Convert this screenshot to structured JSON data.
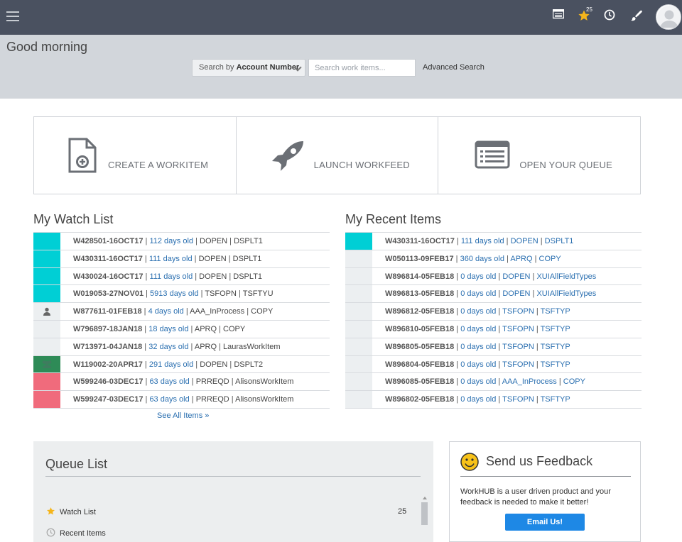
{
  "header": {
    "favorites_count": "25",
    "colors": {
      "bar": "#4a5160",
      "band": "#d2d6db"
    }
  },
  "greeting": "Good morning",
  "search": {
    "by_prefix": "Search by",
    "by_value": "Account Number",
    "placeholder": "Search work items...",
    "advanced_label": "Advanced Search"
  },
  "tiles": [
    {
      "label": "CREATE A WORKITEM",
      "icon": "document-add-icon"
    },
    {
      "label": "LAUNCH WORKFEED",
      "icon": "rocket-icon"
    },
    {
      "label": "OPEN YOUR QUEUE",
      "icon": "queue-list-icon"
    }
  ],
  "watch_list": {
    "title": "My Watch List",
    "see_all": "See All Items »",
    "rows": [
      {
        "id": "W428501-16OCT17",
        "age": "112 days old",
        "status": "DOPEN",
        "type": "DSPLT1",
        "color": "#00cfd5",
        "icon": ""
      },
      {
        "id": "W430311-16OCT17",
        "age": "111 days old",
        "status": "DOPEN",
        "type": "DSPLT1",
        "color": "#00cfd5",
        "icon": ""
      },
      {
        "id": "W430024-16OCT17",
        "age": "111 days old",
        "status": "DOPEN",
        "type": "DSPLT1",
        "color": "#00cfd5",
        "icon": ""
      },
      {
        "id": "W019053-27NOV01",
        "age": "5913 days old",
        "status": "TSFOPN",
        "type": "TSFTYU",
        "color": "#00cfd5",
        "icon": ""
      },
      {
        "id": "W877611-01FEB18",
        "age": "4 days old",
        "status": "AAA_InProcess",
        "type": "COPY",
        "color": "#eceff1",
        "icon": "person-icon"
      },
      {
        "id": "W796897-18JAN18",
        "age": "18 days old",
        "status": "APRQ",
        "type": "COPY",
        "color": "#eceff1",
        "icon": ""
      },
      {
        "id": "W713971-04JAN18",
        "age": "32 days old",
        "status": "APRQ",
        "type": "LaurasWorkItem",
        "color": "#eceff1",
        "icon": ""
      },
      {
        "id": "W119002-20APR17",
        "age": "291 days old",
        "status": "DOPEN",
        "type": "DSPLT2",
        "color": "#2e8b57",
        "icon": "group-icon"
      },
      {
        "id": "W599246-03DEC17",
        "age": "63 days old",
        "status": "PRREQD",
        "type": "AlisonsWorkItem",
        "color": "#f06b7c",
        "icon": ""
      },
      {
        "id": "W599247-03DEC17",
        "age": "63 days old",
        "status": "PRREQD",
        "type": "AlisonsWorkItem",
        "color": "#f06b7c",
        "icon": ""
      }
    ]
  },
  "recent_items": {
    "title": "My Recent Items",
    "rows": [
      {
        "id": "W430311-16OCT17",
        "age": "111 days old",
        "status": "DOPEN",
        "type": "DSPLT1",
        "color": "#00cfd5"
      },
      {
        "id": "W050113-09FEB17",
        "age": "360 days old",
        "status": "APRQ",
        "type": "COPY",
        "color": "#eceff1"
      },
      {
        "id": "W896814-05FEB18",
        "age": "0 days old",
        "status": "DOPEN",
        "type": "XUIAllFieldTypes",
        "color": "#eceff1"
      },
      {
        "id": "W896813-05FEB18",
        "age": "0 days old",
        "status": "DOPEN",
        "type": "XUIAllFieldTypes",
        "color": "#eceff1"
      },
      {
        "id": "W896812-05FEB18",
        "age": "0 days old",
        "status": "TSFOPN",
        "type": "TSFTYP",
        "color": "#eceff1"
      },
      {
        "id": "W896810-05FEB18",
        "age": "0 days old",
        "status": "TSFOPN",
        "type": "TSFTYP",
        "color": "#eceff1"
      },
      {
        "id": "W896805-05FEB18",
        "age": "0 days old",
        "status": "TSFOPN",
        "type": "TSFTYP",
        "color": "#eceff1"
      },
      {
        "id": "W896804-05FEB18",
        "age": "0 days old",
        "status": "TSFOPN",
        "type": "TSFTYP",
        "color": "#eceff1"
      },
      {
        "id": "W896085-05FEB18",
        "age": "0 days old",
        "status": "AAA_InProcess",
        "type": "COPY",
        "color": "#eceff1"
      },
      {
        "id": "W896802-05FEB18",
        "age": "0 days old",
        "status": "TSFOPN",
        "type": "TSFTYP",
        "color": "#eceff1"
      }
    ]
  },
  "queue_list": {
    "title": "Queue List",
    "items": [
      {
        "label": "Watch List",
        "count": "25",
        "icon": "star-icon"
      },
      {
        "label": "Recent Items",
        "count": "",
        "icon": "clock-icon"
      }
    ]
  },
  "feedback": {
    "title": "Send us Feedback",
    "text": "WorkHUB is a user driven product and your feedback is needed to make it better!",
    "button": "Email Us!"
  }
}
